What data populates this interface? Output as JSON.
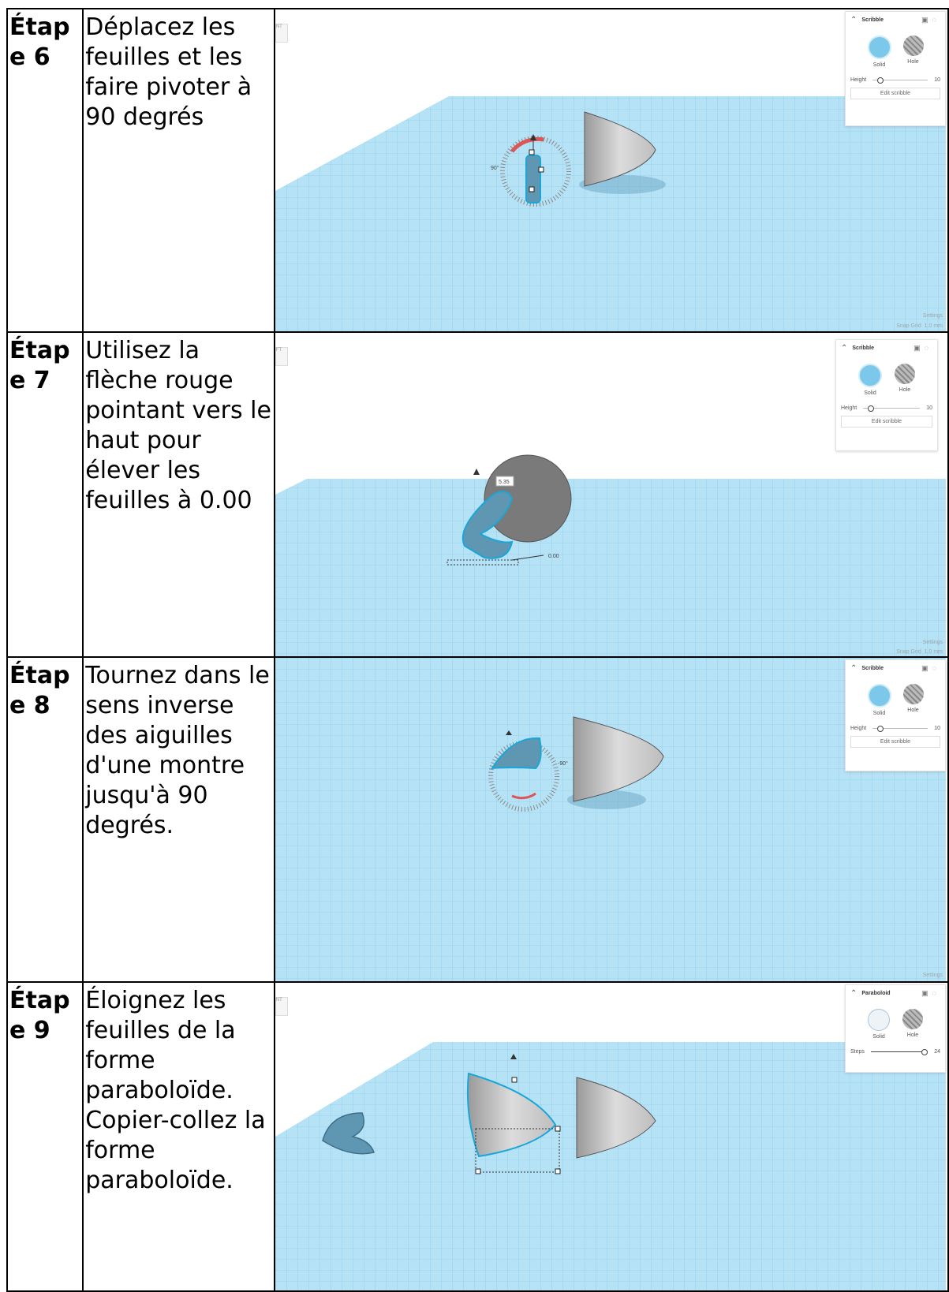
{
  "rows": [
    {
      "step": "Étape 6",
      "text": "Déplacez les feuilles et les faire pivoter à 90 degrés",
      "panel": {
        "title": "Scribble",
        "solid": "Solid",
        "hole": "Hole",
        "param_label": "Height",
        "param_value": "10",
        "button": "Edit scribble"
      },
      "annotation": "90°",
      "footer_settings": "Settings",
      "footer_snap": "Snap Grid",
      "footer_snap_value": "1.0 mm",
      "side_tab": "NT"
    },
    {
      "step": "Étape 7",
      "text": "Utilisez la flèche rouge pointant vers le haut pour élever les feuilles à 0.00",
      "panel": {
        "title": "Scribble",
        "solid": "Solid",
        "hole": "Hole",
        "param_label": "Height",
        "param_value": "10",
        "button": "Edit scribble"
      },
      "annotation": "5.35",
      "annotation2": "0.00",
      "footer_settings": "Settings",
      "footer_snap": "Snap Grid",
      "footer_snap_value": "1.0 mm",
      "side_tab": "FT"
    },
    {
      "step": "Étape 8",
      "text": "Tournez dans le sens inverse des aiguilles d'une montre jusqu'à 90 degrés.",
      "panel": {
        "title": "Scribble",
        "solid": "Solid",
        "hole": "Hole",
        "param_label": "Height",
        "param_value": "10",
        "button": "Edit scribble"
      },
      "annotation": "-90°",
      "footer_settings": "Settings"
    },
    {
      "step": "Étape 9",
      "text": "Éloignez les feuilles de la forme paraboloïde. Copier-collez la forme paraboloïde.",
      "panel": {
        "title": "Paraboloid",
        "solid": "Solid",
        "hole": "Hole",
        "param_label": "Steps",
        "param_value": "24"
      },
      "side_tab": "NT"
    }
  ],
  "colors": {
    "workplane": "#a9dcf3",
    "grid_line": "#7cc3e6",
    "leaf": "#5f97b3",
    "selection": "#1aa6d8",
    "shape": "#cfcfcf"
  }
}
